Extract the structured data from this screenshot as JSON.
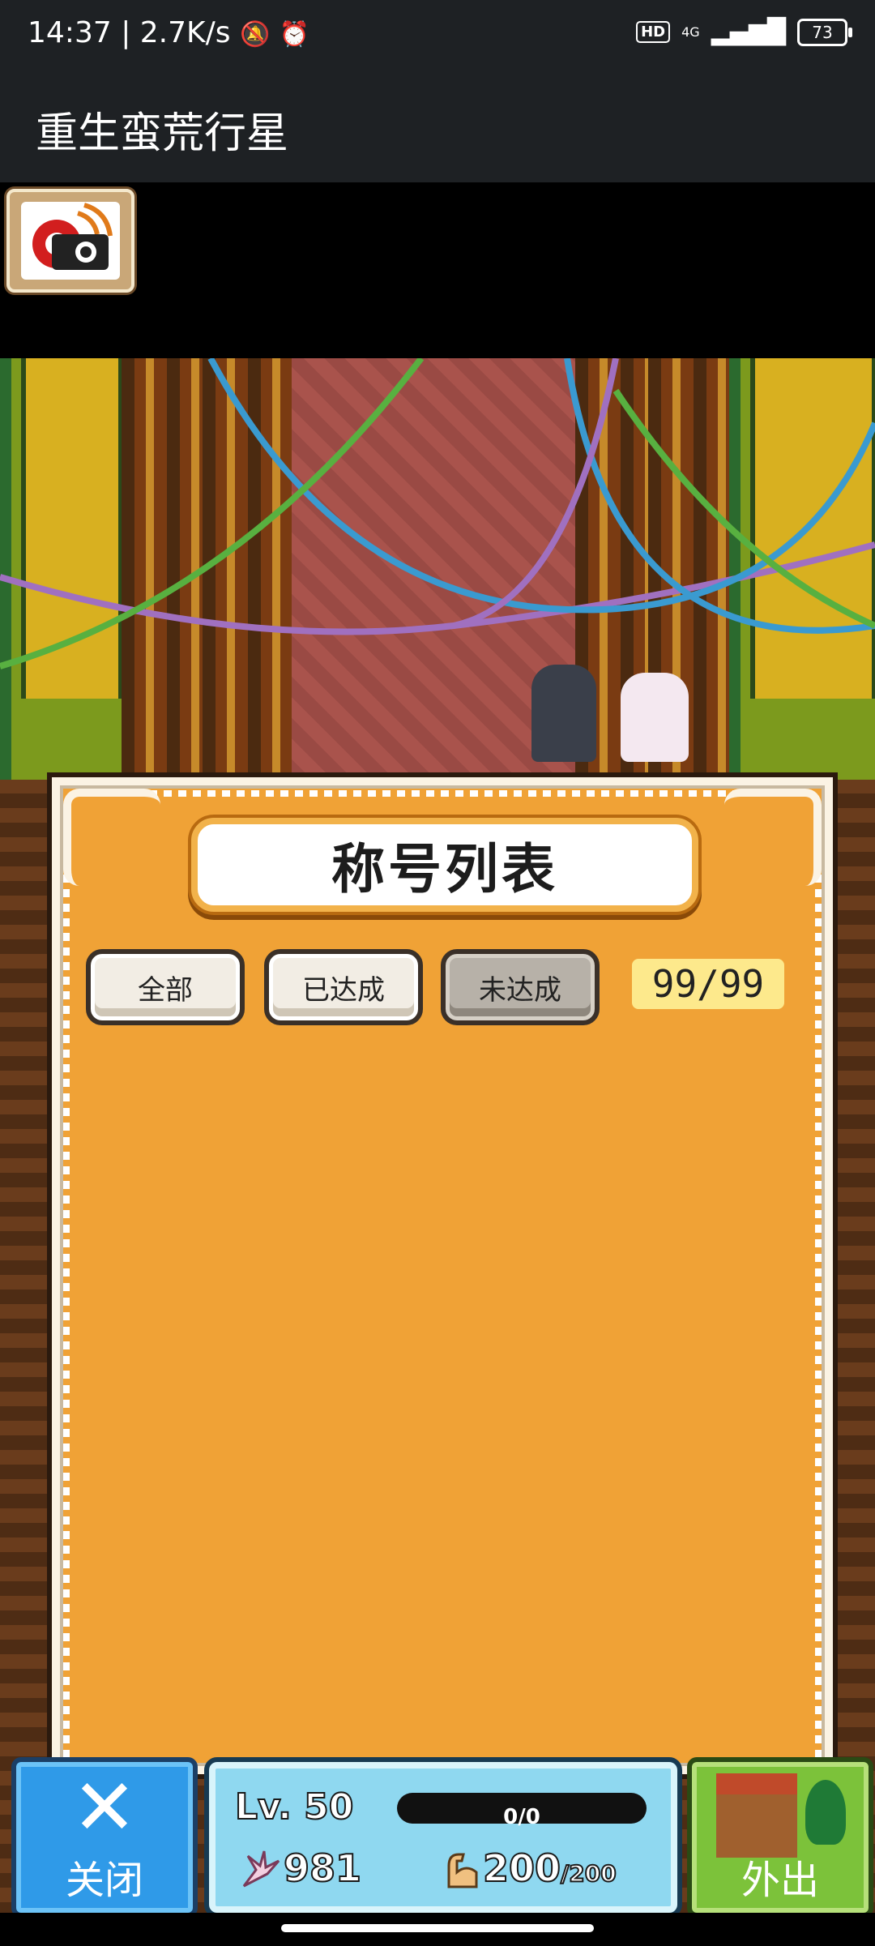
{
  "status_bar": {
    "time": "14:37",
    "speed": "2.7K/s",
    "hd_badge": "HD",
    "network": "4G",
    "battery": "73"
  },
  "app": {
    "title": "重生蛮荒行星"
  },
  "dialog": {
    "title": "称号列表",
    "filters": [
      "全部",
      "已达成",
      "未达成"
    ],
    "active_filter": "未达成",
    "counter": "99/99"
  },
  "player": {
    "level": "Lv. 50",
    "exp": "0/0",
    "resource_a": "981",
    "resource_b": "200",
    "resource_b_max": "/200"
  },
  "buttons": {
    "close": "关闭",
    "go_out": "外出"
  },
  "icons": {
    "camera": "camera-icon",
    "close": "close-x-icon",
    "claw": "claw-icon",
    "strength": "flexed-arm-icon",
    "outing": "house-icon"
  },
  "colors": {
    "dialog_bg": "#f0a236",
    "close_button": "#2f9ae8",
    "out_button": "#7cc23a",
    "counter_bg": "#fde98c"
  }
}
